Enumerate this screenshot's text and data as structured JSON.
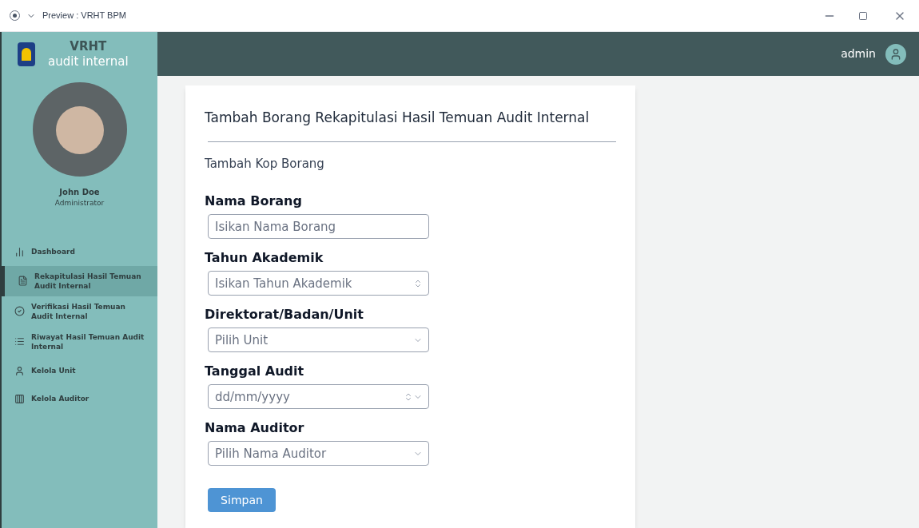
{
  "window": {
    "title": "Preview : VRHT BPM"
  },
  "brand": {
    "title": "VRHT",
    "subtitle": "audit internal"
  },
  "user": {
    "name": "John Doe",
    "role": "Administrator"
  },
  "sidebar": {
    "items": [
      {
        "label": "Dashboard",
        "selected": false
      },
      {
        "label": "Rekapitulasi Hasil Temuan Audit Internal",
        "selected": true
      },
      {
        "label": "Verifikasi Hasil Temuan Audit Internal",
        "selected": false
      },
      {
        "label": "Riwayat Hasil Temuan Audit Internal",
        "selected": false
      },
      {
        "label": "Kelola Unit",
        "selected": false
      },
      {
        "label": "Kelola Auditor",
        "selected": false
      }
    ]
  },
  "header": {
    "username": "admin"
  },
  "form": {
    "title": "Tambah Borang Rekapitulasi Hasil Temuan Audit Internal",
    "subtitle": "Tambah Kop Borang",
    "fields": [
      {
        "kind": "text",
        "label": "Nama Borang",
        "placeholder": "Isikan Nama Borang"
      },
      {
        "kind": "number",
        "label": "Tahun Akademik",
        "placeholder": "Isikan Tahun Akademik"
      },
      {
        "kind": "select",
        "label": "Direktorat/Badan/Unit",
        "placeholder": "Pilih Unit"
      },
      {
        "kind": "date",
        "label": "Tanggal Audit",
        "placeholder": "dd/mm/yyyy"
      },
      {
        "kind": "select",
        "label": "Nama Auditor",
        "placeholder": "Pilih Nama Auditor"
      }
    ],
    "submit": "Simpan"
  }
}
